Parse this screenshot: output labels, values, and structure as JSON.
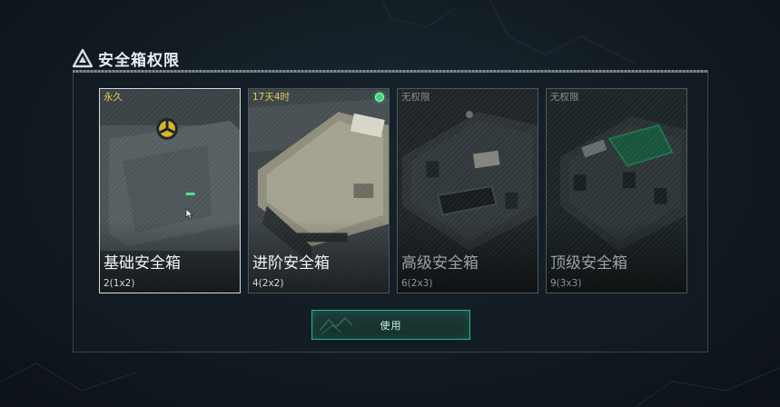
{
  "header": {
    "title": "安全箱权限",
    "icon": "warning-triangle-icon"
  },
  "cards": [
    {
      "tag": "永久",
      "tag_color": "#e8c85a",
      "name": "基础安全箱",
      "size": "2(1x2)",
      "selected": true,
      "active": false
    },
    {
      "tag": "17天4时",
      "tag_color": "#e8c85a",
      "name": "进阶安全箱",
      "size": "4(2x2)",
      "selected": false,
      "active": true
    },
    {
      "tag": "无权限",
      "tag_color": "#8a8f91",
      "name": "高级安全箱",
      "size": "6(2x3)",
      "selected": false,
      "active": false
    },
    {
      "tag": "无权限",
      "tag_color": "#8a8f91",
      "name": "顶级安全箱",
      "size": "9(3x3)",
      "selected": false,
      "active": false
    }
  ],
  "use_button": {
    "label": "使用"
  },
  "colors": {
    "accent": "#29b58a",
    "status_active": "#3bd67a",
    "tag_permanent": "#e8c85a",
    "tag_locked": "#8a8f91"
  }
}
